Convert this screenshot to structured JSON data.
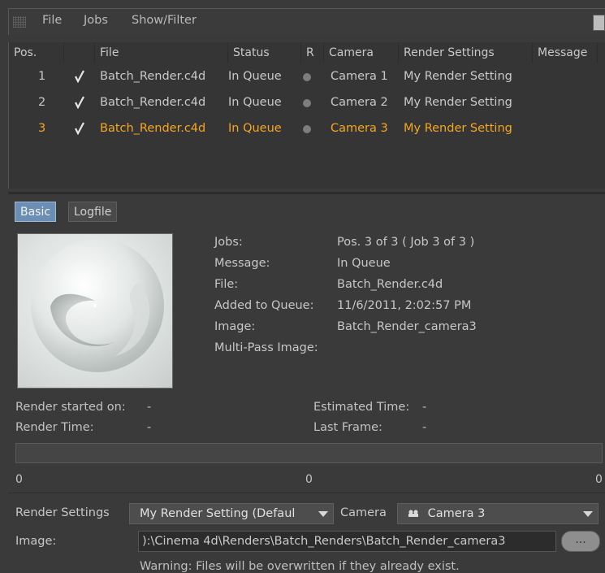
{
  "menubar": {
    "items": [
      "File",
      "Jobs",
      "Show/Filter"
    ]
  },
  "table": {
    "columns": [
      "Pos.",
      "File",
      "Status",
      "R",
      "Camera",
      "Render Settings",
      "Message"
    ],
    "rows": [
      {
        "pos": "1",
        "checked": true,
        "file": "Batch_Render.c4d",
        "status": "In Queue",
        "camera": "Camera 1",
        "settings": "My Render Setting",
        "message": ""
      },
      {
        "pos": "2",
        "checked": true,
        "file": "Batch_Render.c4d",
        "status": "In Queue",
        "camera": "Camera 2",
        "settings": "My Render Setting",
        "message": ""
      },
      {
        "pos": "3",
        "checked": true,
        "file": "Batch_Render.c4d",
        "status": "In Queue",
        "camera": "Camera 3",
        "settings": "My Render Setting",
        "message": ""
      }
    ],
    "selected_row": 2
  },
  "tabs": [
    "Basic",
    "Logfile"
  ],
  "info": {
    "jobs_label": "Jobs:",
    "jobs_value": "Pos. 3 of 3 ( Job 3 of 3 )",
    "message_label": "Message:",
    "message_value": "In Queue",
    "file_label": "File:",
    "file_value": "Batch_Render.c4d",
    "added_label": "Added to Queue:",
    "added_value": "11/6/2011, 2:02:57 PM",
    "image_label": "Image:",
    "image_value": "Batch_Render_camera3",
    "multipass_label": "Multi-Pass Image:",
    "multipass_value": ""
  },
  "stats": {
    "started_label": "Render started on:",
    "started_value": "-",
    "est_label": "Estimated Time:",
    "est_value": "-",
    "time_label": "Render Time:",
    "time_value": "-",
    "last_label": "Last Frame:",
    "last_value": "-"
  },
  "progress": {
    "left": "0",
    "mid": "0",
    "right": "0"
  },
  "bottom": {
    "settings_label": "Render Settings",
    "settings_value": "My Render Setting (Defaul",
    "camera_label": "Camera",
    "camera_value": "Camera 3",
    "image_label": "Image:",
    "image_path": "):\\Cinema 4d\\Renders\\Batch_Renders\\Batch_Render_camera3",
    "browse_label": "...",
    "warning": "Warning: Files will be overwritten if they already exist."
  },
  "colors": {
    "selected_text": "#f5a623",
    "tab_active": "#6b8fb4",
    "background": "#3a3a3a"
  }
}
